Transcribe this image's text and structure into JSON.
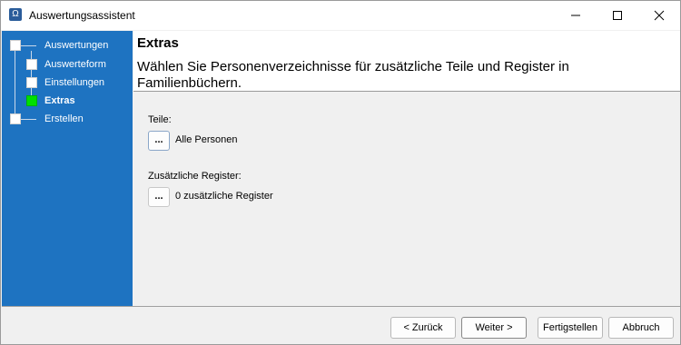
{
  "window": {
    "title": "Auswertungsassistent",
    "app_icon_glyph": "Ω"
  },
  "sidebar": {
    "items": [
      {
        "label": "Auswertungen",
        "active": false
      },
      {
        "label": "Auswerteform",
        "active": false
      },
      {
        "label": "Einstellungen",
        "active": false
      },
      {
        "label": "Extras",
        "active": true
      },
      {
        "label": "Erstellen",
        "active": false
      }
    ]
  },
  "header": {
    "title": "Extras",
    "subtitle": "Wählen Sie Personenverzeichnisse für zusätzliche Teile und Register in Familienbüchern."
  },
  "fields": {
    "teile": {
      "label": "Teile:",
      "button": "...",
      "value": "Alle Personen"
    },
    "register": {
      "label": "Zusätzliche Register:",
      "button": "...",
      "value": "0 zusätzliche Register"
    }
  },
  "footer": {
    "back": "< Zurück",
    "next": "Weiter >",
    "finish": "Fertigstellen",
    "cancel": "Abbruch"
  },
  "colors": {
    "sidebar": "#1e73c1",
    "active_node": "#00e000"
  }
}
